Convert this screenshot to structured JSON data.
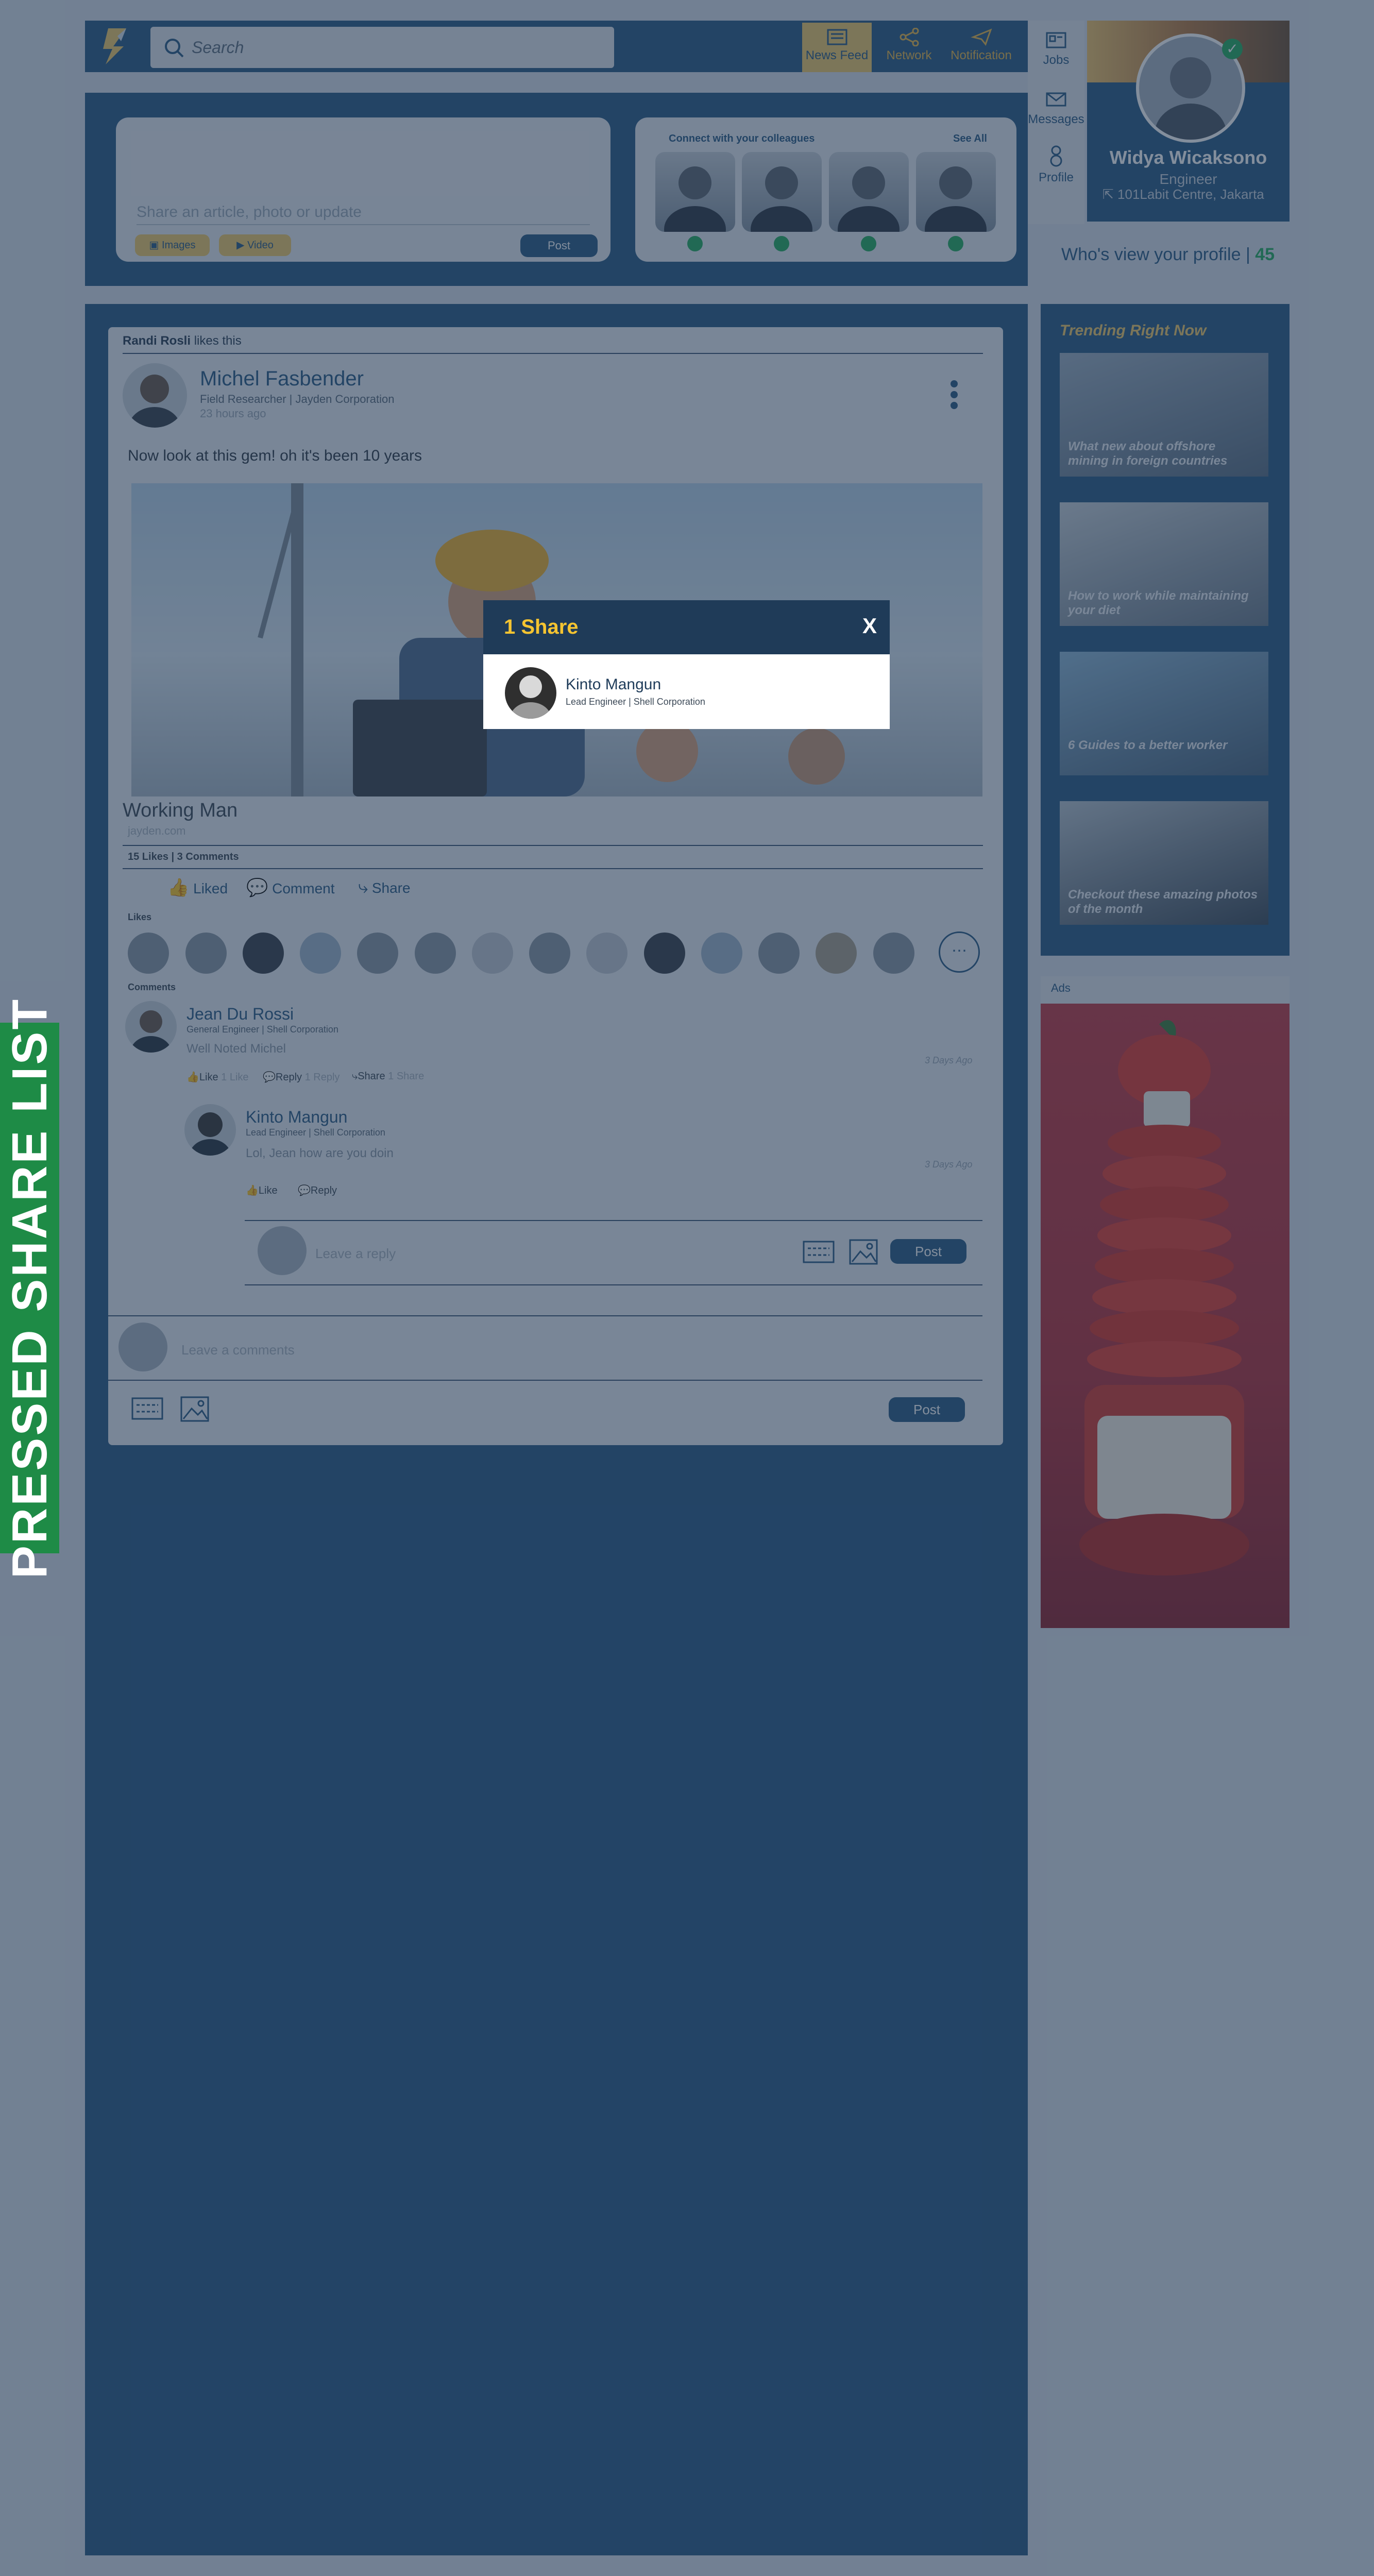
{
  "search": {
    "placeholder": "Search"
  },
  "nav": [
    {
      "label": "News Feed",
      "icon": "news-feed-icon",
      "active": true
    },
    {
      "label": "Network",
      "icon": "network-icon",
      "active": false
    },
    {
      "label": "Notification",
      "icon": "notification-icon",
      "active": false
    }
  ],
  "sidebar": [
    {
      "label": "Jobs",
      "icon": "jobs-icon"
    },
    {
      "label": "Messages",
      "icon": "messages-icon"
    },
    {
      "label": "Profile",
      "icon": "profile-icon"
    }
  ],
  "profile": {
    "name": "Widya Wicaksono",
    "role": "Engineer",
    "location": "101Labit Centre, Jakarta",
    "views_label": "Who's view your profile |",
    "views_count": "45"
  },
  "composer": {
    "placeholder": "Share an article, photo or update",
    "images_label": "Images",
    "video_label": "Video",
    "post_label": "Post"
  },
  "colleagues": {
    "title": "Connect with your colleagues",
    "see_all": "See All"
  },
  "post": {
    "liked_by": "Randi Rosli",
    "liked_text": "likes this",
    "author": "Michel Fasbender",
    "author_role": "Field Researcher | Jayden Corporation",
    "time": "23 hours ago",
    "text": "Now look at this gem! oh it's been 10 years",
    "image_title": "Working Man",
    "image_sub": "jayden.com",
    "stats": "15 Likes | 3 Comments",
    "liked_label": "Liked",
    "comment_label": "Comment",
    "share_label": "Share",
    "likes_heading": "Likes",
    "comments_heading": "Comments",
    "comment_input_placeholder": "Leave a comments",
    "post_label": "Post"
  },
  "comments": [
    {
      "name": "Jean Du Rossi",
      "role": "General Engineer | Shell Corporation",
      "text": "Well Noted Michel",
      "time": "3 Days Ago",
      "like": "Like",
      "like_count": "1 Like",
      "reply": "Reply",
      "reply_count": "1 Reply",
      "share": "Share",
      "share_count": "1 Share"
    },
    {
      "name": "Kinto Mangun",
      "role": "Lead Engineer | Shell Corporation",
      "text": "Lol, Jean how are you doin",
      "time": "3 Days Ago",
      "like": "Like",
      "reply": "Reply"
    }
  ],
  "reply_box": {
    "placeholder": "Leave a reply",
    "post_label": "Post"
  },
  "trending": {
    "title": "Trending Right Now",
    "items": [
      {
        "caption": "What new about offshore mining in foreign countries"
      },
      {
        "caption": "How to work while maintaining your diet"
      },
      {
        "caption": "6 Guides to a better worker"
      },
      {
        "caption": "Checkout these amazing photos of the month"
      }
    ]
  },
  "ads": {
    "label": "Ads"
  },
  "modal": {
    "title": "1 Share",
    "close": "X",
    "sharer_name": "Kinto Mangun",
    "sharer_role": "Lead Engineer | Shell Corporation"
  },
  "overlay_tag": "PRESSED SHARE LIST",
  "colors": {
    "navy": "#2a5b86",
    "gold": "#f0c96a",
    "modal_title": "#f5c431",
    "tag_green": "#1e8b46"
  }
}
